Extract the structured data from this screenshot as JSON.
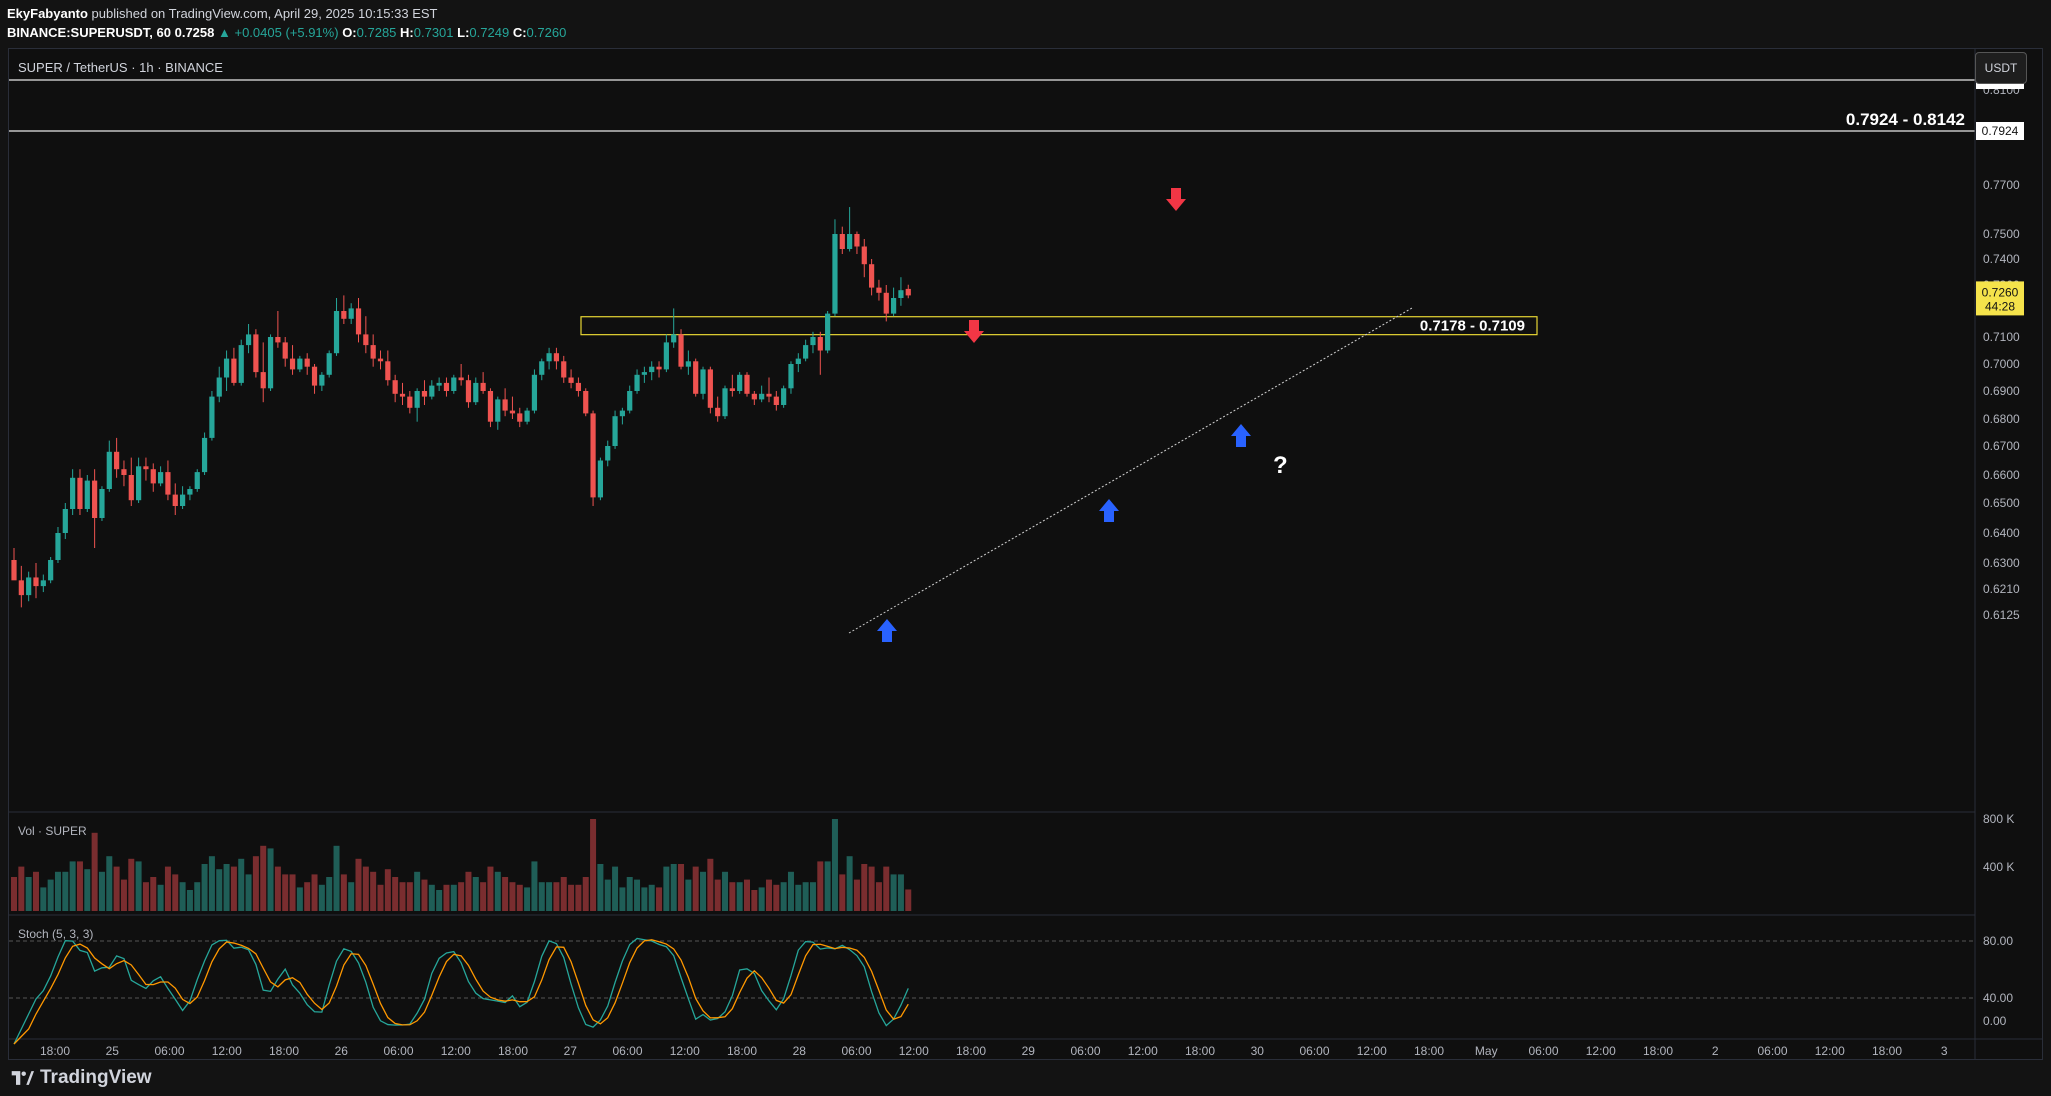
{
  "header": {
    "author": "EkyFabyanto",
    "published_text": "published on TradingView.com, April 29, 2025 10:15:33 EST",
    "symbol_line": "BINANCE:SUPERUSDT, 60",
    "last": "0.7258",
    "change": "▲ +0.0405 (+5.91%)",
    "o_label": "O:",
    "o_value": "0.7285",
    "h_label": "H:",
    "h_value": "0.7301",
    "l_label": "L:",
    "l_value": "0.7249",
    "c_label": "C:",
    "c_value": "0.7260"
  },
  "chart_title": "SUPER / TetherUS · 1h · BINANCE",
  "currency_button": "USDT",
  "volume_pane": {
    "label": "Vol · SUPER",
    "ticks": [
      "800 K",
      "400 K"
    ]
  },
  "stoch_pane": {
    "label": "Stoch (5, 3, 3)",
    "ticks": [
      "80.00",
      "40.00",
      "0.00"
    ]
  },
  "footer": {
    "brand": "TradingView"
  },
  "colors": {
    "up": "#26a69a",
    "down": "#ef5350",
    "background": "#0f0f0f",
    "zone": "#e6d534",
    "arrow_up": "#2962ff",
    "arrow_down": "#f23645",
    "stoch_k": "#26a69a",
    "stoch_d": "#ff9800",
    "current_price": "#f5e34b"
  },
  "annotations": {
    "resistance_zone_label": "0.7924 - 0.8142",
    "support_zone_label": "0.7178 - 0.7109",
    "question_mark": "?",
    "level_tags": [
      "0.8142",
      "0.7924"
    ],
    "current_price_tag": "0.7260",
    "countdown": "44:28",
    "arrows_up": 3,
    "arrows_down": 2
  },
  "chart_data": {
    "type": "candlestick",
    "price_axis_ticks": [
      "0.8100",
      "0.7700",
      "0.7500",
      "0.7400",
      "0.7300",
      "0.7100",
      "0.7000",
      "0.6900",
      "0.6800",
      "0.6700",
      "0.6600",
      "0.6500",
      "0.6400",
      "0.6300",
      "0.6210",
      "0.6125"
    ],
    "time_axis_ticks": [
      "18:00",
      "25",
      "06:00",
      "12:00",
      "18:00",
      "26",
      "06:00",
      "12:00",
      "18:00",
      "27",
      "06:00",
      "12:00",
      "18:00",
      "28",
      "06:00",
      "12:00",
      "18:00",
      "29",
      "06:00",
      "12:00",
      "18:00",
      "30",
      "06:00",
      "12:00",
      "18:00",
      "May",
      "06:00",
      "12:00",
      "18:00",
      "2",
      "06:00",
      "12:00",
      "18:00",
      "3"
    ],
    "horizontal_levels": [
      0.8142,
      0.7924
    ],
    "support_zone": [
      0.7109,
      0.7178
    ],
    "trendline": {
      "from": [
        "28 05:00",
        0.6455
      ],
      "to": [
        "30 06:00",
        0.7365
      ]
    },
    "arrows": [
      {
        "dir": "up",
        "time": "28 07:00",
        "price": 0.642
      },
      {
        "dir": "up",
        "time": "29 06:00",
        "price": 0.678
      },
      {
        "dir": "up",
        "time": "29 20:00",
        "price": 0.6995
      },
      {
        "dir": "down",
        "time": "28 19:00",
        "price": 0.729
      },
      {
        "dir": "down",
        "time": "29 15:00",
        "price": 0.764
      }
    ],
    "candles_ohlc": [
      [
        0.631,
        0.635,
        0.625,
        0.624
      ],
      [
        0.624,
        0.629,
        0.615,
        0.619
      ],
      [
        0.619,
        0.627,
        0.617,
        0.625
      ],
      [
        0.625,
        0.63,
        0.618,
        0.622
      ],
      [
        0.622,
        0.626,
        0.62,
        0.624
      ],
      [
        0.624,
        0.632,
        0.623,
        0.631
      ],
      [
        0.631,
        0.642,
        0.63,
        0.64
      ],
      [
        0.64,
        0.65,
        0.638,
        0.648
      ],
      [
        0.648,
        0.662,
        0.646,
        0.659
      ],
      [
        0.659,
        0.662,
        0.646,
        0.648
      ],
      [
        0.648,
        0.66,
        0.647,
        0.658
      ],
      [
        0.658,
        0.662,
        0.635,
        0.645
      ],
      [
        0.645,
        0.656,
        0.644,
        0.655
      ],
      [
        0.655,
        0.672,
        0.654,
        0.668
      ],
      [
        0.668,
        0.673,
        0.659,
        0.662
      ],
      [
        0.662,
        0.665,
        0.656,
        0.66
      ],
      [
        0.66,
        0.666,
        0.649,
        0.651
      ],
      [
        0.651,
        0.666,
        0.65,
        0.663
      ],
      [
        0.663,
        0.666,
        0.658,
        0.662
      ],
      [
        0.662,
        0.664,
        0.654,
        0.657
      ],
      [
        0.657,
        0.663,
        0.656,
        0.661
      ],
      [
        0.661,
        0.665,
        0.651,
        0.653
      ],
      [
        0.653,
        0.657,
        0.646,
        0.649
      ],
      [
        0.649,
        0.656,
        0.648,
        0.653
      ],
      [
        0.653,
        0.656,
        0.651,
        0.655
      ],
      [
        0.655,
        0.662,
        0.654,
        0.661
      ],
      [
        0.661,
        0.675,
        0.66,
        0.673
      ],
      [
        0.673,
        0.69,
        0.672,
        0.688
      ],
      [
        0.688,
        0.699,
        0.686,
        0.695
      ],
      [
        0.695,
        0.705,
        0.69,
        0.702
      ],
      [
        0.702,
        0.706,
        0.692,
        0.693
      ],
      [
        0.693,
        0.709,
        0.692,
        0.707
      ],
      [
        0.707,
        0.715,
        0.704,
        0.711
      ],
      [
        0.711,
        0.713,
        0.695,
        0.697
      ],
      [
        0.697,
        0.708,
        0.686,
        0.691
      ],
      [
        0.691,
        0.711,
        0.69,
        0.71
      ],
      [
        0.71,
        0.72,
        0.706,
        0.708
      ],
      [
        0.708,
        0.71,
        0.699,
        0.702
      ],
      [
        0.702,
        0.707,
        0.696,
        0.698
      ],
      [
        0.698,
        0.703,
        0.697,
        0.702
      ],
      [
        0.702,
        0.704,
        0.696,
        0.699
      ],
      [
        0.699,
        0.7,
        0.689,
        0.692
      ],
      [
        0.692,
        0.697,
        0.69,
        0.696
      ],
      [
        0.696,
        0.705,
        0.695,
        0.704
      ],
      [
        0.704,
        0.725,
        0.703,
        0.72
      ],
      [
        0.72,
        0.726,
        0.715,
        0.717
      ],
      [
        0.717,
        0.723,
        0.715,
        0.721
      ],
      [
        0.721,
        0.725,
        0.708,
        0.711
      ],
      [
        0.711,
        0.718,
        0.704,
        0.707
      ],
      [
        0.707,
        0.711,
        0.699,
        0.702
      ],
      [
        0.702,
        0.705,
        0.698,
        0.701
      ],
      [
        0.701,
        0.705,
        0.692,
        0.694
      ],
      [
        0.694,
        0.696,
        0.686,
        0.689
      ],
      [
        0.689,
        0.693,
        0.685,
        0.688
      ],
      [
        0.688,
        0.69,
        0.682,
        0.684
      ],
      [
        0.684,
        0.691,
        0.679,
        0.69
      ],
      [
        0.69,
        0.694,
        0.685,
        0.688
      ],
      [
        0.688,
        0.694,
        0.687,
        0.692
      ],
      [
        0.692,
        0.695,
        0.69,
        0.693
      ],
      [
        0.693,
        0.695,
        0.688,
        0.69
      ],
      [
        0.69,
        0.696,
        0.689,
        0.695
      ],
      [
        0.695,
        0.7,
        0.692,
        0.694
      ],
      [
        0.694,
        0.696,
        0.684,
        0.686
      ],
      [
        0.686,
        0.695,
        0.685,
        0.693
      ],
      [
        0.693,
        0.697,
        0.689,
        0.69
      ],
      [
        0.69,
        0.691,
        0.677,
        0.679
      ],
      [
        0.679,
        0.688,
        0.676,
        0.687
      ],
      [
        0.687,
        0.691,
        0.681,
        0.683
      ],
      [
        0.683,
        0.688,
        0.68,
        0.682
      ],
      [
        0.682,
        0.684,
        0.677,
        0.679
      ],
      [
        0.679,
        0.684,
        0.678,
        0.683
      ],
      [
        0.683,
        0.698,
        0.682,
        0.696
      ],
      [
        0.696,
        0.702,
        0.694,
        0.701
      ],
      [
        0.701,
        0.706,
        0.698,
        0.704
      ],
      [
        0.704,
        0.706,
        0.698,
        0.701
      ],
      [
        0.701,
        0.703,
        0.693,
        0.695
      ],
      [
        0.695,
        0.698,
        0.691,
        0.693
      ],
      [
        0.693,
        0.695,
        0.688,
        0.69
      ],
      [
        0.69,
        0.691,
        0.681,
        0.682
      ],
      [
        0.682,
        0.683,
        0.649,
        0.652
      ],
      [
        0.652,
        0.666,
        0.651,
        0.665
      ],
      [
        0.665,
        0.672,
        0.663,
        0.67
      ],
      [
        0.67,
        0.683,
        0.669,
        0.681
      ],
      [
        0.681,
        0.684,
        0.678,
        0.683
      ],
      [
        0.683,
        0.692,
        0.682,
        0.69
      ],
      [
        0.69,
        0.698,
        0.689,
        0.696
      ],
      [
        0.696,
        0.699,
        0.693,
        0.697
      ],
      [
        0.697,
        0.701,
        0.694,
        0.699
      ],
      [
        0.699,
        0.701,
        0.695,
        0.698
      ],
      [
        0.698,
        0.711,
        0.697,
        0.708
      ],
      [
        0.708,
        0.721,
        0.706,
        0.711
      ],
      [
        0.711,
        0.713,
        0.698,
        0.699
      ],
      [
        0.699,
        0.705,
        0.696,
        0.701
      ],
      [
        0.701,
        0.702,
        0.688,
        0.689
      ],
      [
        0.689,
        0.699,
        0.687,
        0.698
      ],
      [
        0.698,
        0.699,
        0.682,
        0.684
      ],
      [
        0.684,
        0.688,
        0.679,
        0.681
      ],
      [
        0.681,
        0.692,
        0.68,
        0.691
      ],
      [
        0.691,
        0.696,
        0.688,
        0.69
      ],
      [
        0.69,
        0.697,
        0.689,
        0.696
      ],
      [
        0.696,
        0.697,
        0.688,
        0.689
      ],
      [
        0.689,
        0.69,
        0.685,
        0.687
      ],
      [
        0.687,
        0.692,
        0.686,
        0.689
      ],
      [
        0.689,
        0.695,
        0.686,
        0.688
      ],
      [
        0.688,
        0.69,
        0.683,
        0.685
      ],
      [
        0.685,
        0.692,
        0.684,
        0.691
      ],
      [
        0.691,
        0.701,
        0.689,
        0.7
      ],
      [
        0.7,
        0.704,
        0.697,
        0.702
      ],
      [
        0.702,
        0.709,
        0.701,
        0.707
      ],
      [
        0.707,
        0.712,
        0.704,
        0.71
      ],
      [
        0.71,
        0.712,
        0.696,
        0.705
      ],
      [
        0.705,
        0.72,
        0.704,
        0.719
      ],
      [
        0.719,
        0.756,
        0.718,
        0.75
      ],
      [
        0.75,
        0.753,
        0.742,
        0.744
      ],
      [
        0.744,
        0.761,
        0.743,
        0.75
      ],
      [
        0.75,
        0.751,
        0.742,
        0.745
      ],
      [
        0.745,
        0.748,
        0.733,
        0.738
      ],
      [
        0.738,
        0.74,
        0.726,
        0.729
      ],
      [
        0.729,
        0.732,
        0.724,
        0.727
      ],
      [
        0.727,
        0.73,
        0.716,
        0.719
      ],
      [
        0.719,
        0.729,
        0.718,
        0.725
      ],
      [
        0.725,
        0.733,
        0.722,
        0.728
      ],
      [
        0.7285,
        0.7301,
        0.7249,
        0.726
      ]
    ]
  }
}
